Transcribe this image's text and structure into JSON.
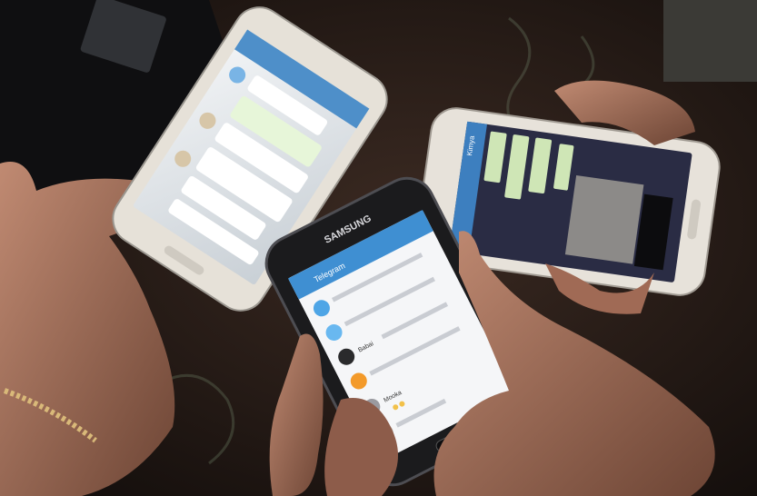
{
  "scene": {
    "phone_top_left": {
      "brand": "",
      "chat_title": "",
      "status_time": ""
    },
    "phone_right": {
      "header_name": "Kimya"
    },
    "phone_front": {
      "brand": "SAMSUNG",
      "app_title": "Telegram",
      "chat_items": [
        {
          "name": ""
        },
        {
          "name": ""
        },
        {
          "name": "Babai"
        },
        {
          "name": ""
        },
        {
          "name": "Mooka"
        }
      ]
    }
  },
  "colors": {
    "telegram_blue": "#3f8fd2",
    "carpet": "#2a1d17",
    "phone_white": "#e9e4dc",
    "phone_black": "#1b1b1d",
    "skin": "#b07a63"
  }
}
